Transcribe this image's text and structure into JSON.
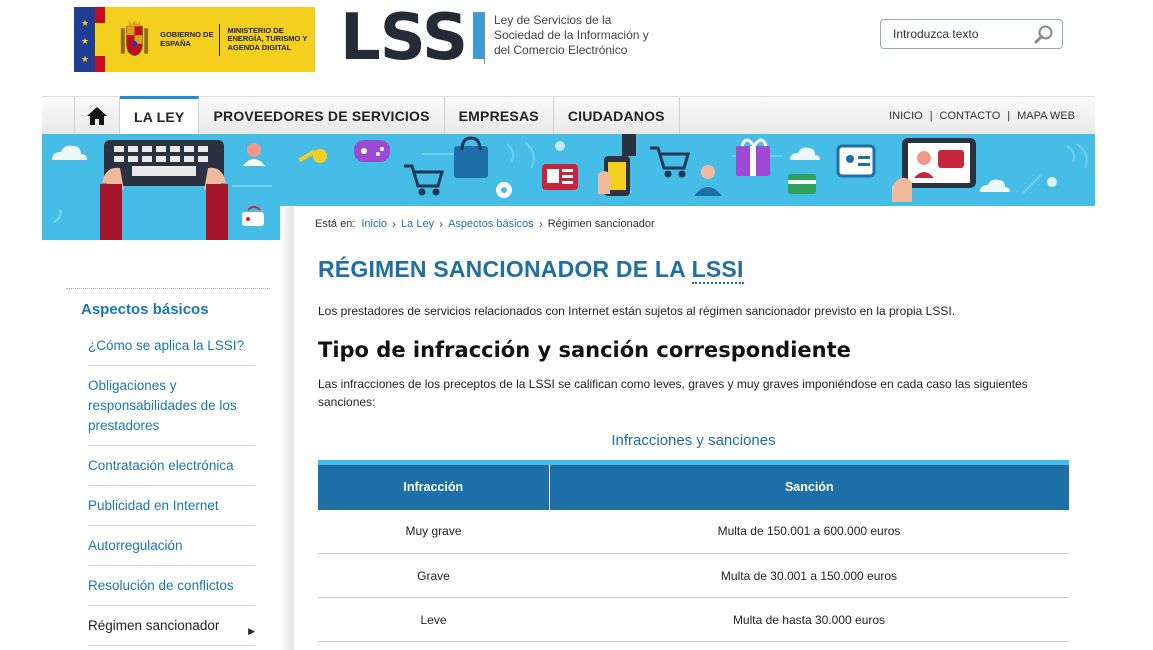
{
  "header": {
    "gov_text": "Gobierno de España",
    "ministry_text": "Ministerio de Energía, Turismo y Agenda Digital",
    "logo_dark": "LSS",
    "logo_blue": "I",
    "subtitle": "Ley de Servicios de la Sociedad de la Información y del Comercio Electrónico",
    "search_placeholder": "Introduzca texto"
  },
  "nav": {
    "items": [
      {
        "label": "LA LEY"
      },
      {
        "label": "PROVEEDORES DE SERVICIOS"
      },
      {
        "label": "EMPRESAS"
      },
      {
        "label": "CIUDADANOS"
      }
    ],
    "top_links": [
      "INICIO",
      "CONTACTO",
      "MAPA WEB"
    ]
  },
  "breadcrumb": {
    "prefix": "Está en:",
    "items": [
      "Inicio",
      "La Ley",
      "Aspectos básicos"
    ],
    "current": "Régimen sancionador"
  },
  "sidebar": {
    "title": "Aspectos básicos",
    "items": [
      {
        "label": "¿Cómo se aplica la LSSI?"
      },
      {
        "label": "Obligaciones y responsabilidades de los prestadores"
      },
      {
        "label": "Contratación electrónica"
      },
      {
        "label": "Publicidad en Internet"
      },
      {
        "label": "Autorregulación"
      },
      {
        "label": "Resolución de conflictos"
      },
      {
        "label": "Régimen sancionador"
      }
    ]
  },
  "main": {
    "title_prefix": "RÉGIMEN SANCIONADOR DE LA ",
    "title_abbr": "LSSI",
    "intro": "Los prestadores de servicios relacionados con Internet están sujetos al régimen sancionador previsto en la propia LSSI.",
    "h2": "Tipo de infracción y sanción correspondiente",
    "paragraph": "Las infracciones de los preceptos de la LSSI se califican como leves, graves y muy graves imponiéndose en cada caso las siguientes sanciones:",
    "table": {
      "caption": "Infracciones y sanciones",
      "headers": [
        "Infracción",
        "Sanción"
      ],
      "rows": [
        [
          "Muy grave",
          "Multa de 150.001 a 600.000 euros"
        ],
        [
          "Grave",
          "Multa de 30.001 a 150.000 euros"
        ],
        [
          "Leve",
          "Multa de hasta 30.000 euros"
        ]
      ]
    }
  },
  "colors": {
    "brand_blue": "#1e6ea8",
    "banner_blue": "#45bde6",
    "link_blue": "#1b76b5",
    "gov_yellow": "#f4cf1e"
  }
}
